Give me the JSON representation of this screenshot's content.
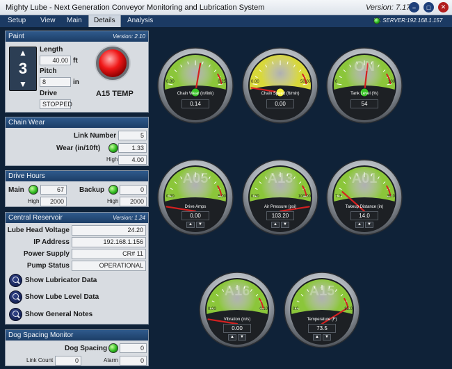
{
  "window": {
    "title": "Mighty Lube - Next Generation Conveyor Monitoring and Lubrication System",
    "version": "Version: 7.17"
  },
  "menu": {
    "items": [
      "Setup",
      "View",
      "Main",
      "Details",
      "Analysis"
    ],
    "active": "Details",
    "server": "ML SERVER:192.168.1.157"
  },
  "paint": {
    "title": "Paint",
    "version": "Version: 2.10",
    "number": "3",
    "length_label": "Length",
    "length_value": "40.00",
    "length_unit": "ft",
    "pitch_label": "Pitch",
    "pitch_value": "8",
    "pitch_unit": "in",
    "drive_label": "Drive",
    "drive_value": "STOPPED",
    "temp_label": "A15 TEMP"
  },
  "chain_wear": {
    "title": "Chain Wear",
    "link_label": "Link Number",
    "link_value": "5",
    "wear_label": "Wear (in/10ft)",
    "wear_value": "1.33",
    "high_label": "High",
    "high_value": "4.00"
  },
  "drive_hours": {
    "title": "Drive Hours",
    "main_label": "Main",
    "main_value": "67",
    "main_high_label": "High",
    "main_high_value": "2000",
    "backup_label": "Backup",
    "backup_value": "0",
    "backup_high_label": "High",
    "backup_high_value": "2000"
  },
  "reservoir": {
    "title": "Central Reservoir",
    "version": "Version: 1.24",
    "rows": [
      {
        "label": "Lube Head Voltage",
        "value": "24.20"
      },
      {
        "label": "IP Address",
        "value": "192.168.1.156"
      },
      {
        "label": "Power Supply",
        "value": "CR# 11"
      },
      {
        "label": "Pump Status",
        "value": "OPERATIONAL"
      }
    ],
    "links": [
      "Show Lubricator Data",
      "Show Lube Level Data",
      "Show General Notes"
    ]
  },
  "dog_spacing": {
    "title": "Dog Spacing Monitor",
    "label": "Dog Spacing",
    "value": "0",
    "count_label": "Link Count",
    "count_value": "0",
    "alarm_label": "Alarm",
    "alarm_value": "0"
  },
  "gauges": [
    {
      "id": "chain-wear",
      "label": "Chain Wear (in/link)",
      "min": "0.00",
      "max": "0.25",
      "value": "0.14",
      "fraction": 0.56,
      "face": "green",
      "watermark": "",
      "hub": "green",
      "arrows": false
    },
    {
      "id": "chain-speed",
      "label": "Chain Speed (ft/min)",
      "min": "0.00",
      "max": "50.00",
      "value": "0.00",
      "fraction": 0.0,
      "face": "yellow",
      "watermark": "",
      "hub": "yellow",
      "arrows": false
    },
    {
      "id": "tank-level",
      "label": "Tank Level (%)",
      "min": "0",
      "max": "100",
      "value": "54",
      "fraction": 0.54,
      "face": "green",
      "watermark": "ON",
      "hub": "green",
      "arrows": false
    },
    {
      "id": "drive-amps",
      "label": "Drive Amps",
      "min": "0.00",
      "max": "5.00",
      "value": "0.00",
      "fraction": 0.0,
      "face": "green",
      "watermark": "A05",
      "hub": "none",
      "arrows": true
    },
    {
      "id": "air-pressure",
      "label": "Air Pressure (psi)",
      "min": "0.00",
      "max": "100.00",
      "value": "103.20",
      "fraction": 1.0,
      "face": "green",
      "watermark": "A13",
      "hub": "none",
      "arrows": true
    },
    {
      "id": "takeup-distance",
      "label": "Takeup Distance (in)",
      "min": "7.9",
      "max": "39.0",
      "value": "14.0",
      "fraction": 0.2,
      "face": "green",
      "watermark": "A01",
      "hub": "none",
      "arrows": true
    },
    {
      "id": "vibration",
      "label": "Vibration (in/s)",
      "min": "0.00",
      "max": "0.10",
      "value": "0.00",
      "fraction": 0.0,
      "face": "green",
      "watermark": "A16",
      "hub": "none",
      "arrows": true
    },
    {
      "id": "temperature",
      "label": "Temperature (F)",
      "min": "0.0",
      "max": "85.0",
      "value": "73.5",
      "fraction": 0.86,
      "face": "green",
      "watermark": "A15",
      "hub": "none",
      "arrows": true
    }
  ],
  "colors": {
    "background": "#0f2238",
    "panel_header": "#1c3d66",
    "face_green": "#8bc63a",
    "face_yellow": "#d8d83a",
    "needle": "#d42020"
  }
}
